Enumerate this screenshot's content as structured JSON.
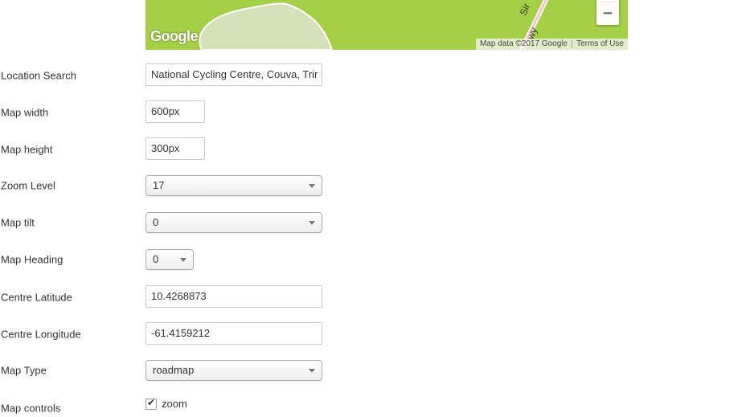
{
  "map": {
    "logo": "Google",
    "road_labels": [
      "Sir",
      "wy"
    ],
    "attribution": "Map data ©2017 Google",
    "terms": "Terms of Use",
    "zoom_in": "+",
    "zoom_out": "−",
    "colors": {
      "land": "#a4cf46",
      "park": "#d4e1b9",
      "road": "#f3c6c6"
    }
  },
  "form": {
    "location_search": {
      "label": "Location Search",
      "value": "National Cycling Centre, Couva, Trir"
    },
    "map_width": {
      "label": "Map width",
      "value": "600px"
    },
    "map_height": {
      "label": "Map height",
      "value": "300px"
    },
    "zoom_level": {
      "label": "Zoom Level",
      "value": "17"
    },
    "map_tilt": {
      "label": "Map tilt",
      "value": "0"
    },
    "map_heading": {
      "label": "Map Heading",
      "value": "0"
    },
    "centre_latitude": {
      "label": "Centre Latitude",
      "value": "10.4268873"
    },
    "centre_longitude": {
      "label": "Centre Longitude",
      "value": "-61.4159212"
    },
    "map_type": {
      "label": "Map Type",
      "value": "roadmap"
    },
    "map_controls": {
      "label": "Map controls",
      "zoom_option": "zoom",
      "zoom_checked": true
    }
  }
}
